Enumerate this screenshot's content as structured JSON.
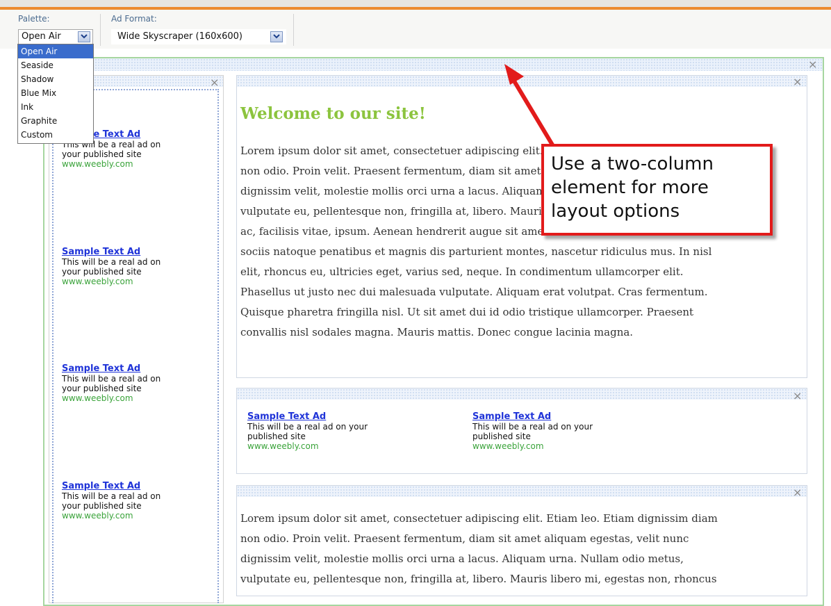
{
  "toolbar": {
    "palette_label": "Palette:",
    "palette_value": "Open Air",
    "ad_format_label": "Ad Format:",
    "ad_format_value": "Wide Skyscraper (160x600)"
  },
  "palette_options": [
    "Open Air",
    "Seaside",
    "Shadow",
    "Blue Mix",
    "Ink",
    "Graphite",
    "Custom"
  ],
  "close_glyph": "×",
  "ads": {
    "title": "Sample Text Ad",
    "sidebar_desc": [
      "This will be a real ad on",
      "your published site"
    ],
    "url": "www.weebly.com",
    "inline_desc": [
      "This will be a real ad on your",
      "published site"
    ]
  },
  "content": {
    "heading": "Welcome to our site!",
    "para1": [
      "Lorem ipsum dolor sit amet, consectetuer adipiscing elit. Etiam leo. Etiam dignissim diam",
      "non odio. Proin velit. Praesent fermentum, diam sit amet aliquam egestas, velit nunc",
      "dignissim velit, molestie mollis orci urna a lacus. Aliquam urna. Nullam odio metus,",
      "vulputate eu, pellentesque non, fringilla at, libero. Mauris libero mi, egestas non, rhoncus",
      "ac, facilisis vitae, ipsum. Aenean hendrerit augue sit amet enim fermentum luctus. Cum",
      "sociis natoque penatibus et magnis dis parturient montes, nascetur ridiculus mus. In nisl",
      "elit, rhoncus eu, ultricies eget, varius sed, neque. In condimentum ullamcorper elit.",
      "Phasellus ut justo nec dui malesuada vulputate. Aliquam erat volutpat. Cras fermentum.",
      "Quisque pharetra fringilla nisl. Ut sit amet dui id odio tristique ullamcorper. Praesent",
      "convallis nisl sodales magna. Mauris mattis. Donec congue lacinia magna."
    ],
    "para2": [
      "Lorem ipsum dolor sit amet, consectetuer adipiscing elit. Etiam leo. Etiam dignissim diam",
      "non odio. Proin velit. Praesent fermentum, diam sit amet aliquam egestas, velit nunc",
      "dignissim velit, molestie mollis orci urna a lacus. Aliquam urna. Nullam odio metus,",
      "vulputate eu, pellentesque non, fringilla at, libero. Mauris libero mi, egestas non, rhoncus"
    ]
  },
  "callout": {
    "lines": [
      "Use a two-column",
      "element for more",
      "layout options"
    ],
    "color": "#e21b1b"
  },
  "colors": {
    "accent_orange": "#ec8b2f",
    "heading_green": "#8cc43e",
    "ad_link_blue": "#1f33d8",
    "ad_url_green": "#3aa33a",
    "selection_blue": "#3a6ccc"
  }
}
